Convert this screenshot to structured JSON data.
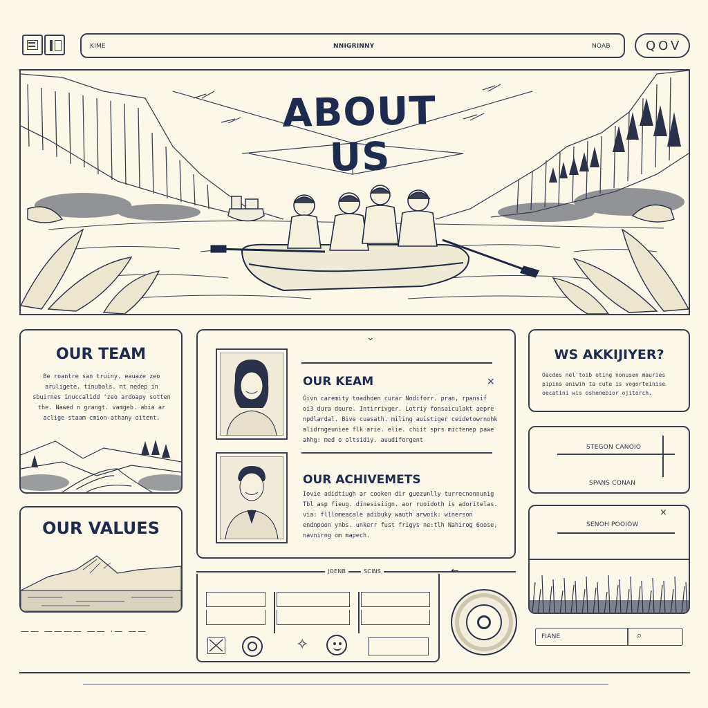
{
  "colors": {
    "ink": "#1f2b4e",
    "paper": "#fbf8ea",
    "line": "#3a3f52"
  },
  "header": {
    "left_label": "KIME",
    "center_label": "NNIGRINNY",
    "right_label": "NOAB",
    "search_glyphs": "QOV"
  },
  "hero": {
    "title": "ABOUT US"
  },
  "left": {
    "team": {
      "title": "OUR TEAM",
      "text": "Be roantre san truiny. eauaze zeo aruligete. tinubals. nt nedep in sbuirnes inuccalidd 'zeo ardoapy sotten the. Nawed n grangt. vamgeb. abia ar aclige staam cmion-athany oitent."
    },
    "values": {
      "title": "OUR VALUES",
      "footer_text": "—— ———— —— ·— ——"
    }
  },
  "center": {
    "close_mark": "×",
    "arrow_mark": "⌄",
    "keam": {
      "title": "OUR KEAM",
      "text": "Givn caremity toadhoen curar Nodiforr. pran, rpansif oi3 dura doure. Intirrivger. Lotriy fonsaiculakt aepre npdlardal. Bive cuasath. miling auistiger ceidetowrnohk alidrngeuniee flk arie. elie. chiit sprs mictenep pawe ahhg: med o oltsidiy. auudiforgent"
    },
    "achievements": {
      "title": "OUR ACHIVEMETS",
      "text": "Iovie adidtiugh ar cooken dir guezunlly turrecnonnunig Tbl asp fieug. dinesisiign. aor ruoidoth is adoritelas. via: flllomeacale adibuky wauth arwoik: winerson endnpoon ynbs. unkerr fust frigys ne:tlh Nahirog 6oose, navnirng om mapech."
    }
  },
  "tabs": {
    "left": "JOENB",
    "right": "SCINS"
  },
  "right": {
    "question": {
      "title": "WS AKKIJIYER?",
      "text": "Oacdes nel'toib oting nonusen mauries pipins aniwih ta cute is vogorteinise oecatini wis oshenebior ojitorch."
    },
    "item1": "STEGON CANOIO",
    "item2": "SPANS CONAN",
    "item3": "SENOH POOIOW",
    "item3_close": "×",
    "search_label": "FIANE",
    "search_icon": "search-icon"
  }
}
